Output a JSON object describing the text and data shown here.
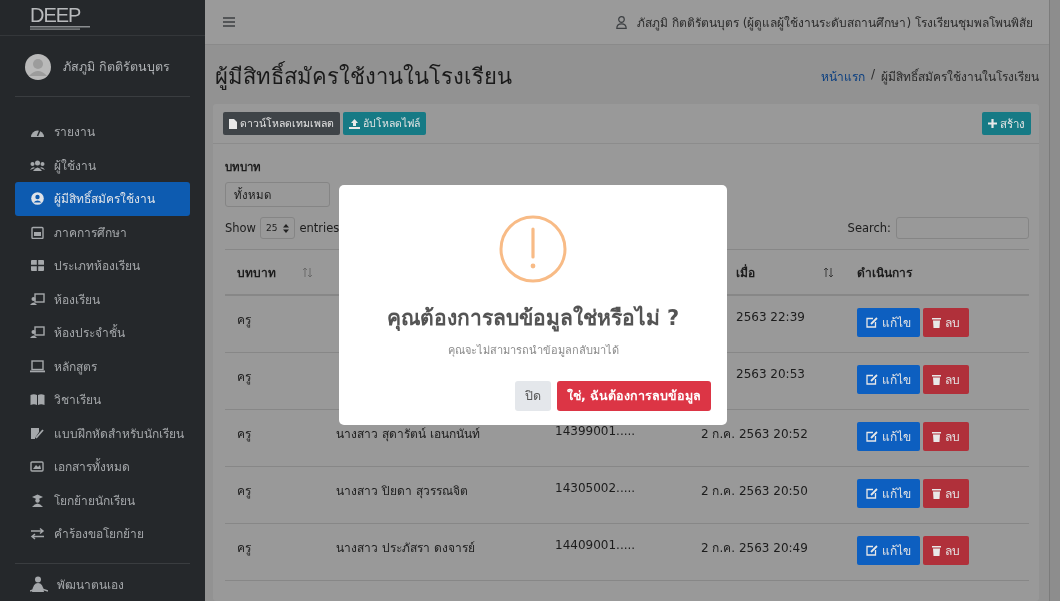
{
  "brand": {
    "logo": "DEEP"
  },
  "sidebar": {
    "user": "ภัสภูมิ กิตติรัตนบุตร",
    "items": [
      {
        "label": "รายงาน",
        "selected": false
      },
      {
        "label": "ผู้ใช้งาน",
        "selected": false
      },
      {
        "label": "ผู้มีสิทธิ์สมัครใช้งาน",
        "selected": true
      },
      {
        "label": "ภาคการศึกษา",
        "selected": false
      },
      {
        "label": "ประเภทห้องเรียน",
        "selected": false
      },
      {
        "label": "ห้องเรียน",
        "selected": false
      },
      {
        "label": "ห้องประจำชั้น",
        "selected": false
      },
      {
        "label": "หลักสูตร",
        "selected": false
      },
      {
        "label": "วิชาเรียน",
        "selected": false
      },
      {
        "label": "แบบฝึกหัดสำหรับนักเรียน",
        "selected": false
      },
      {
        "label": "เอกสารทั้งหมด",
        "selected": false
      },
      {
        "label": "โยกย้ายนักเรียน",
        "selected": false
      },
      {
        "label": "คำร้องขอโยกย้าย",
        "selected": false
      }
    ],
    "footer_items": [
      {
        "label": "พัฒนาตนเอง",
        "selected": false
      }
    ]
  },
  "topbar": {
    "user": "ภัสภูมิ กิตติรัตนบุตร (ผู้ดูแลผู้ใช้งานระดับสถานศึกษา) โรงเรียนชุมพลโพนพิสัย"
  },
  "page": {
    "title": "ผู้มีสิทธิ์สมัครใช้งานในโรงเรียน",
    "separator": "/",
    "breadcrumb": [
      "หน้าแรก",
      "ผู้มีสิทธิ์สมัครใช้งานในโรงเรียน"
    ]
  },
  "toolbar": {
    "buttons": [
      "ดาวน์โหลดเทมเพลต",
      "อัปโหลดไฟล์"
    ],
    "create": "สร้าง"
  },
  "filter": {
    "label": "บทบาท",
    "value": "ทั้งหมด"
  },
  "length": {
    "show": "Show",
    "value": "25",
    "entries": "entries"
  },
  "search": {
    "label": "Search:"
  },
  "table": {
    "columns": [
      {
        "label": "บทบาท"
      },
      {},
      {},
      {
        "label": "เมื่อ"
      },
      {
        "label": "ดำเนินการ"
      }
    ],
    "rows": [
      {
        "role": "ครู",
        "date": "2563 22:39",
        "actions": [
          "แก้ไข",
          "ลบ"
        ]
      },
      {
        "role": "ครู",
        "date": "2563 20:53",
        "actions": [
          "แก้ไข",
          "ลบ"
        ]
      },
      {
        "role": "ครู",
        "name": "นางสาว สุดารัตน์ เอนกนันท์",
        "id": "14399001.....",
        "date": "2 ก.ค. 2563 20:52",
        "actions": [
          "แก้ไข",
          "ลบ"
        ]
      },
      {
        "role": "ครู",
        "name": "นางสาว ปิยดา สุวรรณจิต",
        "id": "14305002.....",
        "date": "2 ก.ค. 2563 20:50",
        "actions": [
          "แก้ไข",
          "ลบ"
        ]
      },
      {
        "role": "ครู",
        "name": "นางสาว ประภัสรา ดงจารย์",
        "id": "14409001.....",
        "date": "2 ก.ค. 2563 20:49",
        "actions": [
          "แก้ไข",
          "ลบ"
        ]
      }
    ]
  },
  "dialog": {
    "title": "คุณต้องการลบข้อมูลใช่หรือไม่ ?",
    "text": "คุณจะไม่สามารถนำข้อมูลกลับมาได้",
    "cancel": "ปิด",
    "confirm": "ใช่, ฉันต้องการลบข้อมูล"
  }
}
